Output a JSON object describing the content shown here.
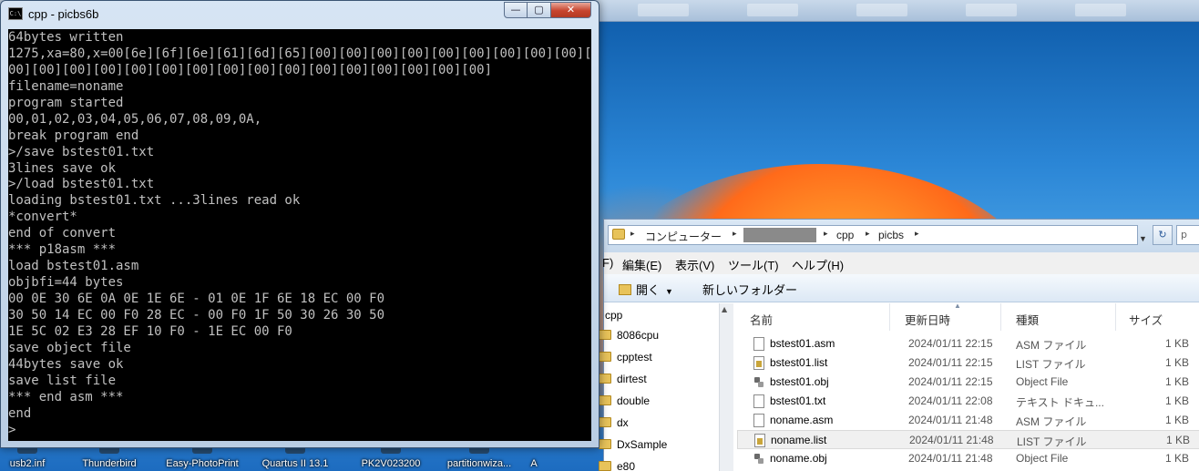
{
  "console": {
    "title": "cpp - picbs6b",
    "icon_text": "C:\\",
    "buttons": {
      "minimize": "—",
      "maximize": "▢",
      "close": "✕"
    },
    "lines": [
      "64bytes written",
      "1275,xa=80,x=00[6e][6f][6e][61][6d][65][00][00][00][00][00][00][00][00][00][00][",
      "00][00][00][00][00][00][00][00][00][00][00][00][00][00][00][00]",
      "filename=noname",
      "program started",
      "00,01,02,03,04,05,06,07,08,09,0A,",
      "break program end",
      ">/save bstest01.txt",
      "3lines save ok",
      ">/load bstest01.txt",
      "loading bstest01.txt ...3lines read ok",
      "*convert*",
      "end of convert",
      "*** p18asm ***",
      "load bstest01.asm",
      "objbfi=44 bytes",
      "00 0E 30 6E 0A 0E 1E 6E - 01 0E 1F 6E 18 EC 00 F0",
      "30 50 14 EC 00 F0 28 EC - 00 F0 1F 50 30 26 30 50",
      "1E 5C 02 E3 28 EF 10 F0 - 1E EC 00 F0",
      "save object file",
      "44bytes save ok",
      "save list file",
      "*** end asm ***",
      "end",
      ">"
    ]
  },
  "desktop_icons": [
    "usb2.inf",
    "Thunderbird",
    "Easy-PhotoPrint",
    "Quartus II 13.1",
    "PK2V023200",
    "partitionwiza...",
    "A"
  ],
  "explorer": {
    "breadcrumb": [
      "コンピューター",
      "cpp",
      "picbs"
    ],
    "refresh_icon": "↻",
    "search_icon": "p",
    "menu": [
      "F)",
      "編集(E)",
      "表示(V)",
      "ツール(T)",
      "ヘルプ(H)"
    ],
    "toolbar": {
      "open_label": "開く",
      "new_folder_label": "新しいフォルダー"
    },
    "nav_items": [
      "cpp",
      "8086cpu",
      "cpptest",
      "dirtest",
      "double",
      "dx",
      "DxSample",
      "e80"
    ],
    "columns": [
      "名前",
      "更新日時",
      "種類",
      "サイズ"
    ],
    "files": [
      {
        "name": "bstest01.asm",
        "date": "2024/01/11 22:15",
        "type": "ASM ファイル",
        "size": "1 KB",
        "icon": "file-icon"
      },
      {
        "name": "bstest01.list",
        "date": "2024/01/11 22:15",
        "type": "LIST ファイル",
        "size": "1 KB",
        "icon": "list-file-icon"
      },
      {
        "name": "bstest01.obj",
        "date": "2024/01/11 22:15",
        "type": "Object File",
        "size": "1 KB",
        "icon": "object-file-icon"
      },
      {
        "name": "bstest01.txt",
        "date": "2024/01/11 22:08",
        "type": "テキスト ドキュ...",
        "size": "1 KB",
        "icon": "file-icon"
      },
      {
        "name": "noname.asm",
        "date": "2024/01/11 21:48",
        "type": "ASM ファイル",
        "size": "1 KB",
        "icon": "file-icon"
      },
      {
        "name": "noname.list",
        "date": "2024/01/11 21:48",
        "type": "LIST ファイル",
        "size": "1 KB",
        "icon": "list-file-icon"
      },
      {
        "name": "noname.obj",
        "date": "2024/01/11 21:48",
        "type": "Object File",
        "size": "1 KB",
        "icon": "object-file-icon"
      }
    ]
  }
}
